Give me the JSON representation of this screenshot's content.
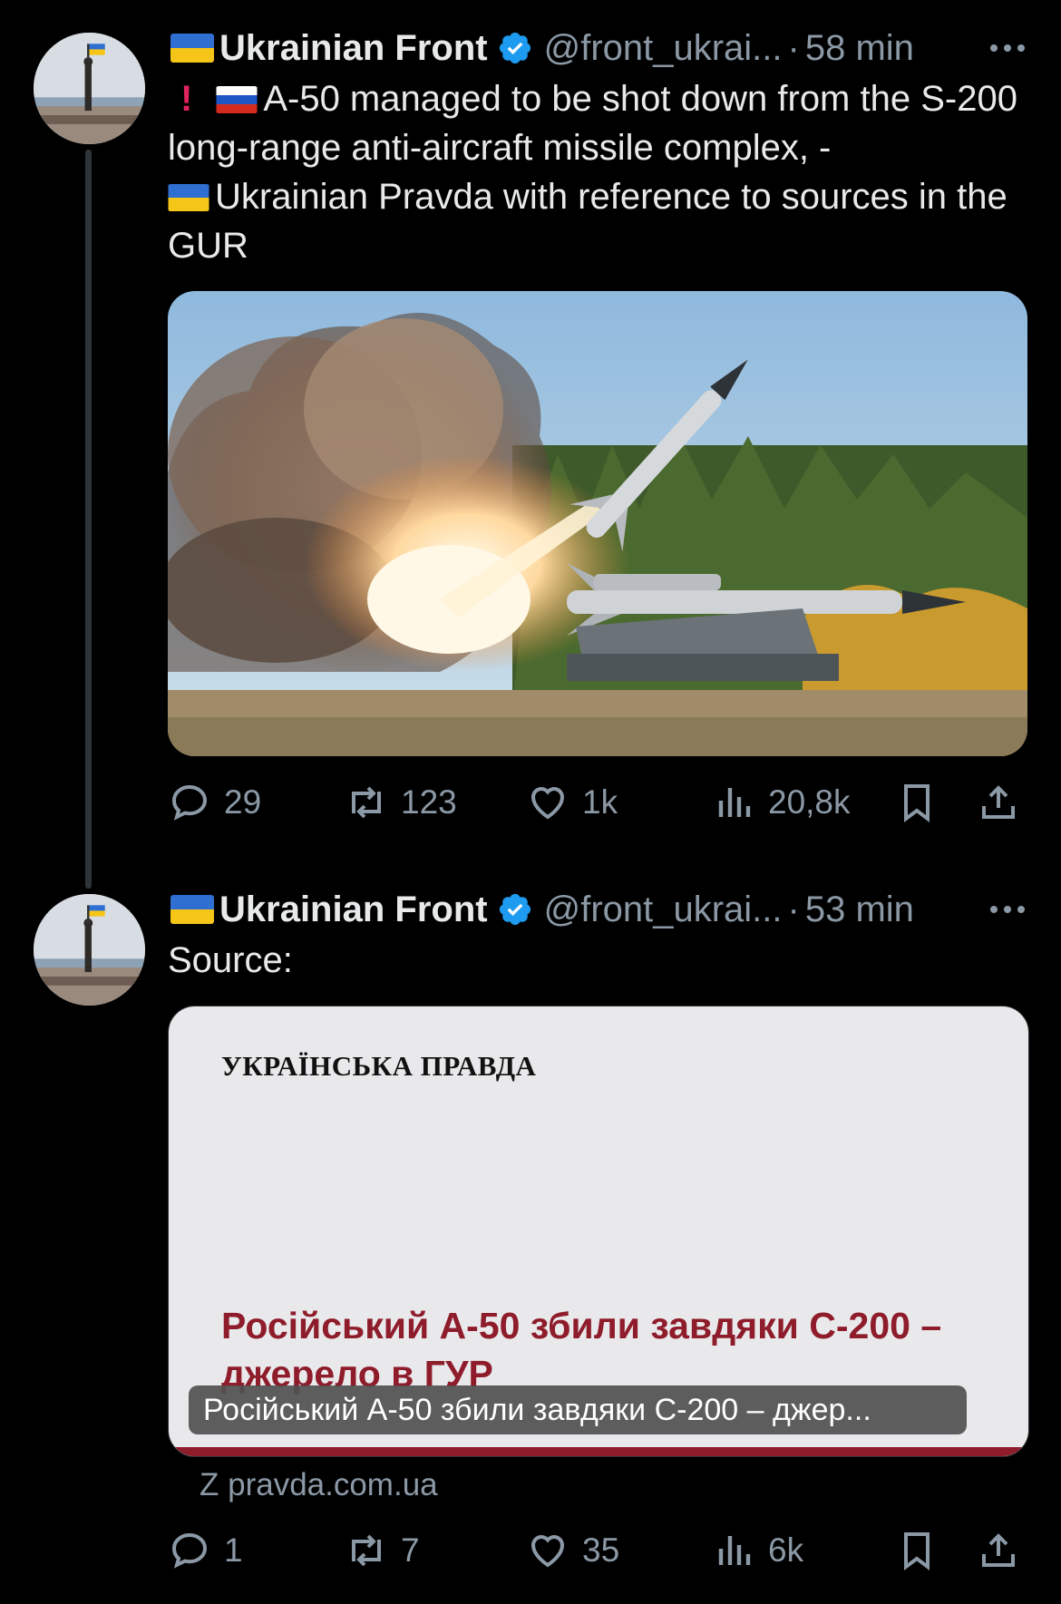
{
  "colors": {
    "background": "#000000",
    "text": "#e7e9ea",
    "secondary": "#8b98a5",
    "verified": "#1d9bf0",
    "headline": "#8e1c2b"
  },
  "tweets": [
    {
      "author": {
        "name": "Ukrainian Front",
        "handle": "@front_ukrai...",
        "avatar_icon": "avatar-statue-flag"
      },
      "time": "58 min",
      "text": {
        "line1": "A-50 managed to be shot down from the S-200 long-range anti-aircraft missile complex, -",
        "line2": "Ukrainian Pravda with reference to sources in the GUR"
      },
      "media": {
        "type": "image",
        "subject": "missile launch"
      },
      "stats": {
        "replies": "29",
        "retweets": "123",
        "likes": "1k",
        "views": "20,8k"
      }
    },
    {
      "author": {
        "name": "Ukrainian Front",
        "handle": "@front_ukrai...",
        "avatar_icon": "avatar-statue-flag"
      },
      "time": "53 min",
      "text": {
        "line1": "Source:"
      },
      "card": {
        "publication": "УКРАЇНСЬКА ПРАВДА",
        "headline": "Російський А-50 збили завдяки С-200 – джерело в ГУР",
        "overlay_title": "Російський А-50 збили завдяки С-200 – джер...",
        "domain": "Z pravda.com.ua"
      },
      "stats": {
        "replies": "1",
        "retweets": "7",
        "likes": "35",
        "views": "6k"
      }
    }
  ]
}
